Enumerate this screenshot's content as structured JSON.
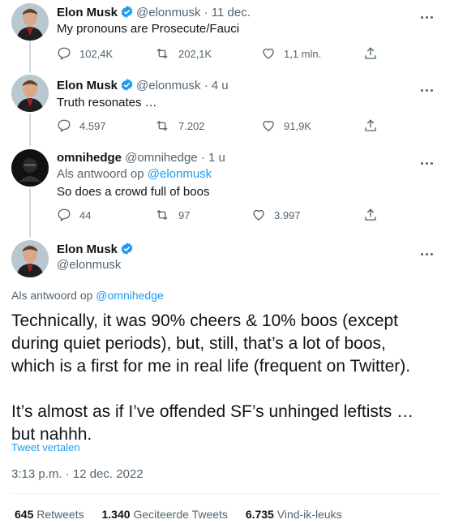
{
  "tweets": [
    {
      "name": "Elon Musk",
      "handle": "@elonmusk",
      "time": "· 11 dec.",
      "text": "My pronouns are Prosecute/Fauci",
      "replies": "102,4K",
      "retweets": "202,1K",
      "likes": "1,1 mln."
    },
    {
      "name": "Elon Musk",
      "handle": "@elonmusk",
      "time": "· 4 u",
      "text": "Truth resonates …",
      "replies": "4.597",
      "retweets": "7.202",
      "likes": "91,9K"
    },
    {
      "name": "omnihedge",
      "handle": "@omnihedge",
      "time": "· 1 u",
      "reply_prefix": "Als antwoord op",
      "reply_handle": "@elonmusk",
      "text": "So does a crowd full of boos",
      "replies": "44",
      "retweets": "97",
      "likes": "3.997"
    }
  ],
  "main_tweet": {
    "name": "Elon Musk",
    "handle": "@elonmusk",
    "reply_prefix": "Als antwoord op",
    "reply_handle": "@omnihedge",
    "text_lines": [
      "Technically, it was 90% cheers & 10% boos (except",
      "during quiet periods), but, still, that’s a lot of boos,",
      "which is a first for me in real life (frequent on Twitter).",
      "It’s almost as if I’ve offended SF’s unhinged leftists …",
      "but nahhh."
    ],
    "translate": "Tweet vertalen",
    "timestamp": "3:13 p.m. · 12 dec. 2022",
    "stats": {
      "retweets_count": "645",
      "retweets_label": "Retweets",
      "quotes_count": "1.340",
      "quotes_label": "Geciteerde Tweets",
      "likes_count": "6.735",
      "likes_label": "Vind-ik-leuks"
    }
  },
  "colors": {
    "accent": "#1d9bf0",
    "text": "#0f1419",
    "secondary": "#536471"
  }
}
